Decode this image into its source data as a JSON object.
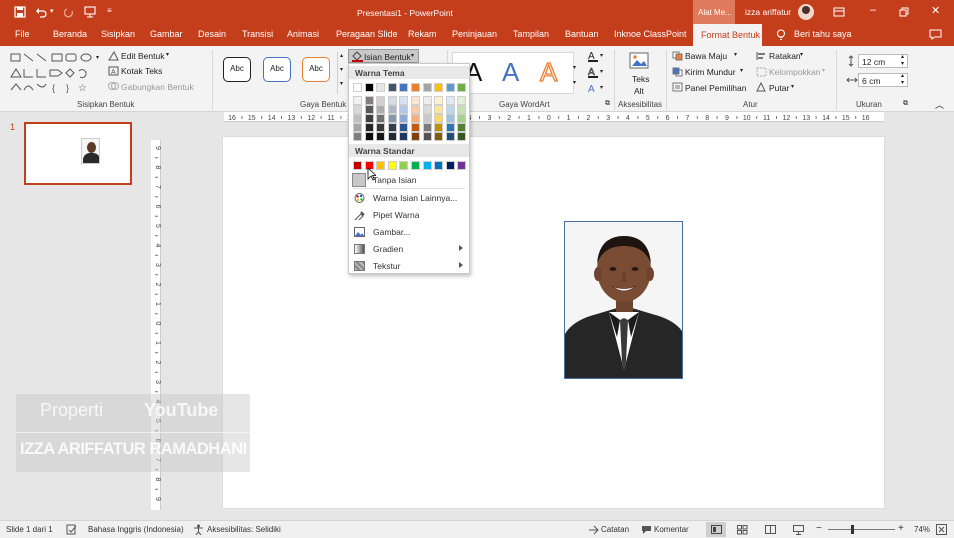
{
  "title_bar": {
    "doc_title": "Presentasi1  -  PowerPoint",
    "contextual_tab": "Alat Me...",
    "user": "izza ariffatur"
  },
  "tabs": [
    "File",
    "Beranda",
    "Sisipkan",
    "Gambar",
    "Desain",
    "Transisi",
    "Animasi",
    "Peragaan Slide",
    "Rekam",
    "Peninjauan",
    "Tampilan",
    "Bantuan",
    "Inknoe ClassPoint",
    "Format Bentuk"
  ],
  "tell_me": "Beri tahu saya",
  "ribbon": {
    "insert_shapes": {
      "edit_shape": "Edit Bentuk",
      "text_box": "Kotak Teks",
      "merge_shapes": "Gabungkan Bentuk",
      "label": "Sisipkan Bentuk"
    },
    "shape_styles": {
      "styles": [
        "Abc",
        "Abc",
        "Abc"
      ],
      "fill_button": "Isian Bentuk",
      "label": "Gaya Bentuk"
    },
    "wordart": {
      "letters": [
        "A",
        "A",
        "A"
      ],
      "label": "Gaya WordArt"
    },
    "accessibility": {
      "alt_text_line1": "Teks",
      "alt_text_line2": "Alt",
      "label": "Aksesibilitas"
    },
    "arrange": {
      "bring_forward": "Bawa Maju",
      "send_backward": "Kirim Mundur",
      "selection_pane": "Panel Pemilihan",
      "align": "Ratakan",
      "group": "Kelompokkan",
      "rotate": "Putar",
      "label": "Atur"
    },
    "size": {
      "height": "12 cm",
      "width": "6 cm",
      "label": "Ukuran"
    }
  },
  "fill_dropdown": {
    "theme_header": "Warna Tema",
    "standard_header": "Warna Standar",
    "theme_top": [
      "#ffffff",
      "#000000",
      "#e7e6e6",
      "#44546a",
      "#4472c4",
      "#ed7d31",
      "#a5a5a5",
      "#ffc000",
      "#5b9bd5",
      "#70ad47"
    ],
    "theme_shades": [
      [
        "#f2f2f2",
        "#7f7f7f",
        "#d0cece",
        "#d6dce4",
        "#d9e2f3",
        "#fbe5d5",
        "#ededed",
        "#fff2cc",
        "#deebf6",
        "#e2efd9"
      ],
      [
        "#d8d8d8",
        "#595959",
        "#aeabab",
        "#adb9ca",
        "#b4c6e7",
        "#f7cbac",
        "#dbdbdb",
        "#fee599",
        "#bdd7ee",
        "#c5e0b3"
      ],
      [
        "#bfbfbf",
        "#3f3f3f",
        "#757070",
        "#8496b0",
        "#8eaadb",
        "#f4b083",
        "#c9c9c9",
        "#ffd965",
        "#9cc3e5",
        "#a8d08d"
      ],
      [
        "#a5a5a5",
        "#262626",
        "#3a3838",
        "#323f4f",
        "#2f5496",
        "#c55a11",
        "#7b7b7b",
        "#bf9000",
        "#2e75b5",
        "#538135"
      ],
      [
        "#7f7f7f",
        "#0c0c0c",
        "#171616",
        "#222a35",
        "#1f3864",
        "#833c0b",
        "#525252",
        "#7f6000",
        "#1e4e79",
        "#375623"
      ]
    ],
    "standard": [
      "#c00000",
      "#ff0000",
      "#ffc000",
      "#ffff00",
      "#92d050",
      "#00b050",
      "#00b0f0",
      "#0070c0",
      "#002060",
      "#7030a0"
    ],
    "no_fill": "Tanpa Isian",
    "more_colors": "Warna Isian Lainnya...",
    "eyedropper": "Pipet Warna",
    "picture": "Gambar...",
    "gradient": "Gradien",
    "texture": "Tekstur"
  },
  "ruler": {
    "h_labels": [
      "16",
      "15",
      "14",
      "13",
      "12",
      "11",
      "10",
      "9",
      "8",
      "7",
      "6",
      "5",
      "4",
      "3",
      "2",
      "1",
      "0",
      "1",
      "2",
      "3",
      "4",
      "5",
      "6",
      "7",
      "8",
      "9",
      "10",
      "11",
      "12",
      "13",
      "14",
      "15",
      "16"
    ],
    "v_labels": [
      "9",
      "8",
      "7",
      "6",
      "5",
      "4",
      "3",
      "2",
      "1",
      "0",
      "1",
      "2",
      "3",
      "4",
      "5",
      "6",
      "7",
      "8",
      "9"
    ]
  },
  "thumbnail": {
    "number": "1"
  },
  "watermark": {
    "line1": "Properti",
    "line2": "YouTube",
    "line3": "IZZA ARIFFATUR RAMADHANI"
  },
  "status": {
    "slide": "Slide 1 dari 1",
    "language": "Bahasa Inggris (Indonesia)",
    "accessibility": "Aksesibilitas: Selidiki",
    "notes": "Catatan",
    "comments": "Komentar",
    "zoom": "74%"
  },
  "colors": {
    "accent": "#c43e1c",
    "contextual": "#e07a5c"
  }
}
